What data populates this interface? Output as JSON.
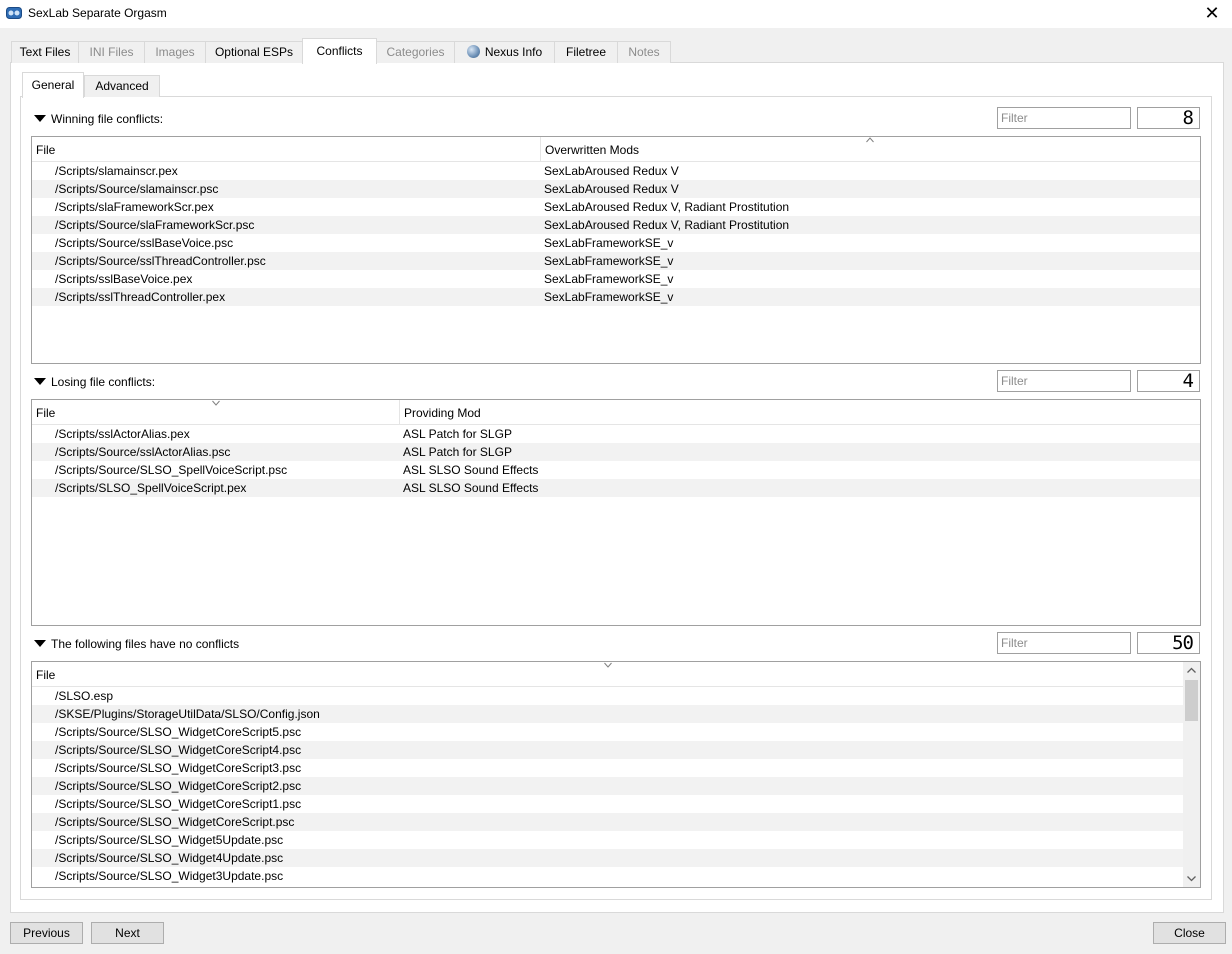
{
  "window": {
    "title": "SexLab Separate Orgasm",
    "close_glyph": "✕"
  },
  "outer_tabs": [
    {
      "label": "Text Files",
      "state": "normal"
    },
    {
      "label": "INI Files",
      "state": "disabled"
    },
    {
      "label": "Images",
      "state": "disabled"
    },
    {
      "label": "Optional ESPs",
      "state": "normal"
    },
    {
      "label": "Conflicts",
      "state": "active"
    },
    {
      "label": "Categories",
      "state": "disabled"
    },
    {
      "label": "Nexus Info",
      "state": "normal",
      "icon": "globe-icon"
    },
    {
      "label": "Filetree",
      "state": "normal"
    },
    {
      "label": "Notes",
      "state": "disabled"
    }
  ],
  "inner_tabs": [
    {
      "label": "General",
      "state": "active"
    },
    {
      "label": "Advanced",
      "state": "normal"
    }
  ],
  "winning": {
    "header": "Winning file conflicts:",
    "filter_placeholder": "Filter",
    "count": "8",
    "columns": [
      "File",
      "Overwritten Mods"
    ],
    "rows": [
      [
        "/Scripts/slamainscr.pex",
        "SexLabAroused Redux V"
      ],
      [
        "/Scripts/Source/slamainscr.psc",
        "SexLabAroused Redux V"
      ],
      [
        "/Scripts/slaFrameworkScr.pex",
        "SexLabAroused Redux V, Radiant Prostitution"
      ],
      [
        "/Scripts/Source/slaFrameworkScr.psc",
        "SexLabAroused Redux V, Radiant Prostitution"
      ],
      [
        "/Scripts/Source/sslBaseVoice.psc",
        "SexLabFrameworkSE_v"
      ],
      [
        "/Scripts/Source/sslThreadController.psc",
        "SexLabFrameworkSE_v"
      ],
      [
        "/Scripts/sslBaseVoice.pex",
        "SexLabFrameworkSE_v"
      ],
      [
        "/Scripts/sslThreadController.pex",
        "SexLabFrameworkSE_v"
      ]
    ]
  },
  "losing": {
    "header": "Losing file conflicts:",
    "filter_placeholder": "Filter",
    "count": "4",
    "columns": [
      "File",
      "Providing Mod"
    ],
    "rows": [
      [
        "/Scripts/sslActorAlias.pex",
        "ASL Patch for SLGP"
      ],
      [
        "/Scripts/Source/sslActorAlias.psc",
        "ASL Patch for SLGP"
      ],
      [
        "/Scripts/Source/SLSO_SpellVoiceScript.psc",
        "ASL SLSO Sound Effects"
      ],
      [
        "/Scripts/SLSO_SpellVoiceScript.pex",
        "ASL SLSO Sound Effects"
      ]
    ]
  },
  "noconflict": {
    "header": "The following files have no conflicts",
    "filter_placeholder": "Filter",
    "count": "50",
    "columns": [
      "File"
    ],
    "rows": [
      "/SLSO.esp",
      "/SKSE/Plugins/StorageUtilData/SLSO/Config.json",
      "/Scripts/Source/SLSO_WidgetCoreScript5.psc",
      "/Scripts/Source/SLSO_WidgetCoreScript4.psc",
      "/Scripts/Source/SLSO_WidgetCoreScript3.psc",
      "/Scripts/Source/SLSO_WidgetCoreScript2.psc",
      "/Scripts/Source/SLSO_WidgetCoreScript1.psc",
      "/Scripts/Source/SLSO_WidgetCoreScript.psc",
      "/Scripts/Source/SLSO_Widget5Update.psc",
      "/Scripts/Source/SLSO_Widget4Update.psc",
      "/Scripts/Source/SLSO_Widget3Update.psc"
    ]
  },
  "buttons": {
    "previous": "Previous",
    "next": "Next",
    "close": "Close"
  }
}
